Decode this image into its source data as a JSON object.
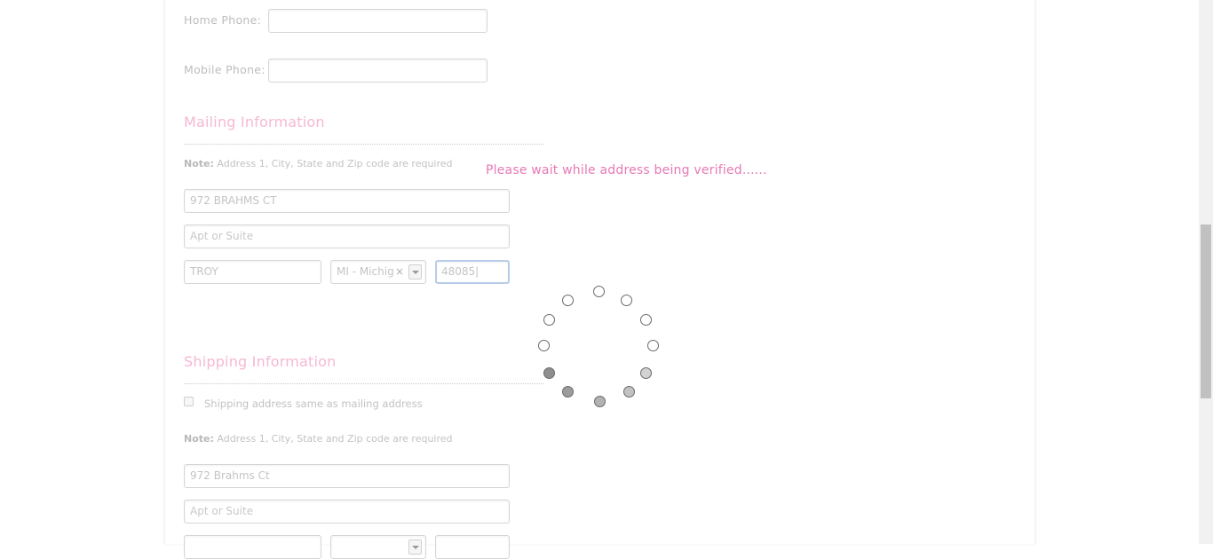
{
  "contact": {
    "home_phone_label": "Home Phone:",
    "home_phone_value": "",
    "mobile_phone_label": "Mobile Phone:",
    "mobile_phone_value": ""
  },
  "mailing": {
    "title": "Mailing Information",
    "note_bold": "Note:",
    "note_text": " Address 1, City, State and Zip code are required",
    "address1": "972 BRAHMS CT",
    "address2_placeholder": "Apt or Suite",
    "city": "TROY",
    "state": "MI - Michig",
    "state_clear": "×",
    "zip": "48085|"
  },
  "overlay": {
    "message": "Please wait while address being verified......"
  },
  "shipping": {
    "title": "Shipping Information",
    "same_as_mailing_label": "Shipping address same as mailing address",
    "same_as_mailing_checked": false,
    "note_bold": "Note:",
    "note_text": " Address 1, City, State and Zip code are required",
    "address1": "972 Brahms Ct",
    "address2_placeholder": "Apt or Suite"
  },
  "colors": {
    "section_title": "#f6b8d4",
    "wait_message": "#e879b6",
    "focus_border": "#b8cdea"
  },
  "icons": {
    "spinner": "loading-spinner-icon",
    "dropdown": "chevron-down-icon",
    "clear": "close-icon"
  }
}
